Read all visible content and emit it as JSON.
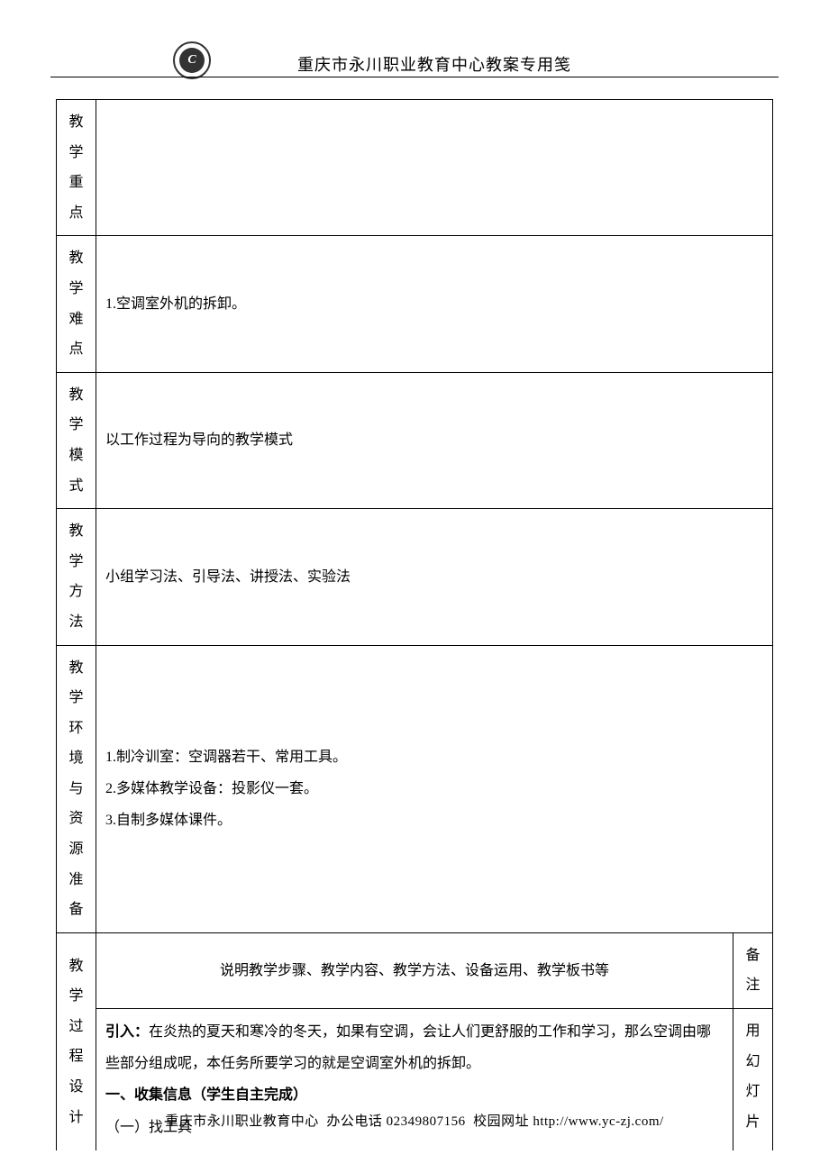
{
  "header": {
    "title": "重庆市永川职业教育中心教案专用笺"
  },
  "rows": {
    "key_point": {
      "label_chars": [
        "教",
        "学",
        "重",
        "点"
      ],
      "content": ""
    },
    "difficulty": {
      "label_chars": [
        "教",
        "学",
        "难",
        "点"
      ],
      "content": "1.空调室外机的拆卸。"
    },
    "mode": {
      "label_chars": [
        "教",
        "学",
        "模",
        "式"
      ],
      "content": "以工作过程为导向的教学模式"
    },
    "method": {
      "label_chars": [
        "教",
        "学",
        "方",
        "法"
      ],
      "content": "小组学习法、引导法、讲授法、实验法"
    },
    "resources": {
      "label_chars": [
        "教",
        "学",
        "环",
        "境",
        "与",
        "资",
        "源",
        "准",
        "备"
      ],
      "lines": [
        "1.制冷训室：空调器若干、常用工具。",
        "2.多媒体教学设备：投影仪一套。",
        "3.自制多媒体课件。"
      ]
    },
    "process": {
      "label_chars": [
        "教",
        "学",
        "过",
        "程",
        "设",
        "计"
      ],
      "header_text": "说明教学步骤、教学内容、教学方法、设备运用、教学板书等",
      "note_header_chars": [
        "备",
        "注"
      ],
      "content_lines": [
        {
          "prefix_bold": "引入：",
          "text": "在炎热的夏天和寒冷的冬天，如果有空调，会让人们更舒服的工作和学习，那么空调由哪些部分组成呢，本任务所要学习的就是空调室外机的拆卸。"
        },
        {
          "bold": "一、收集信息（学生自主完成）"
        },
        {
          "text": "（一）找工具"
        }
      ],
      "note_chars": [
        "用",
        "幻",
        "灯",
        "片"
      ]
    }
  },
  "footer": {
    "org": "重庆市永川职业教育中心",
    "phone_label": "办公电话",
    "phone": "02349807156",
    "url_label": "校园网址",
    "url": "http://www.yc-zj.com/"
  }
}
